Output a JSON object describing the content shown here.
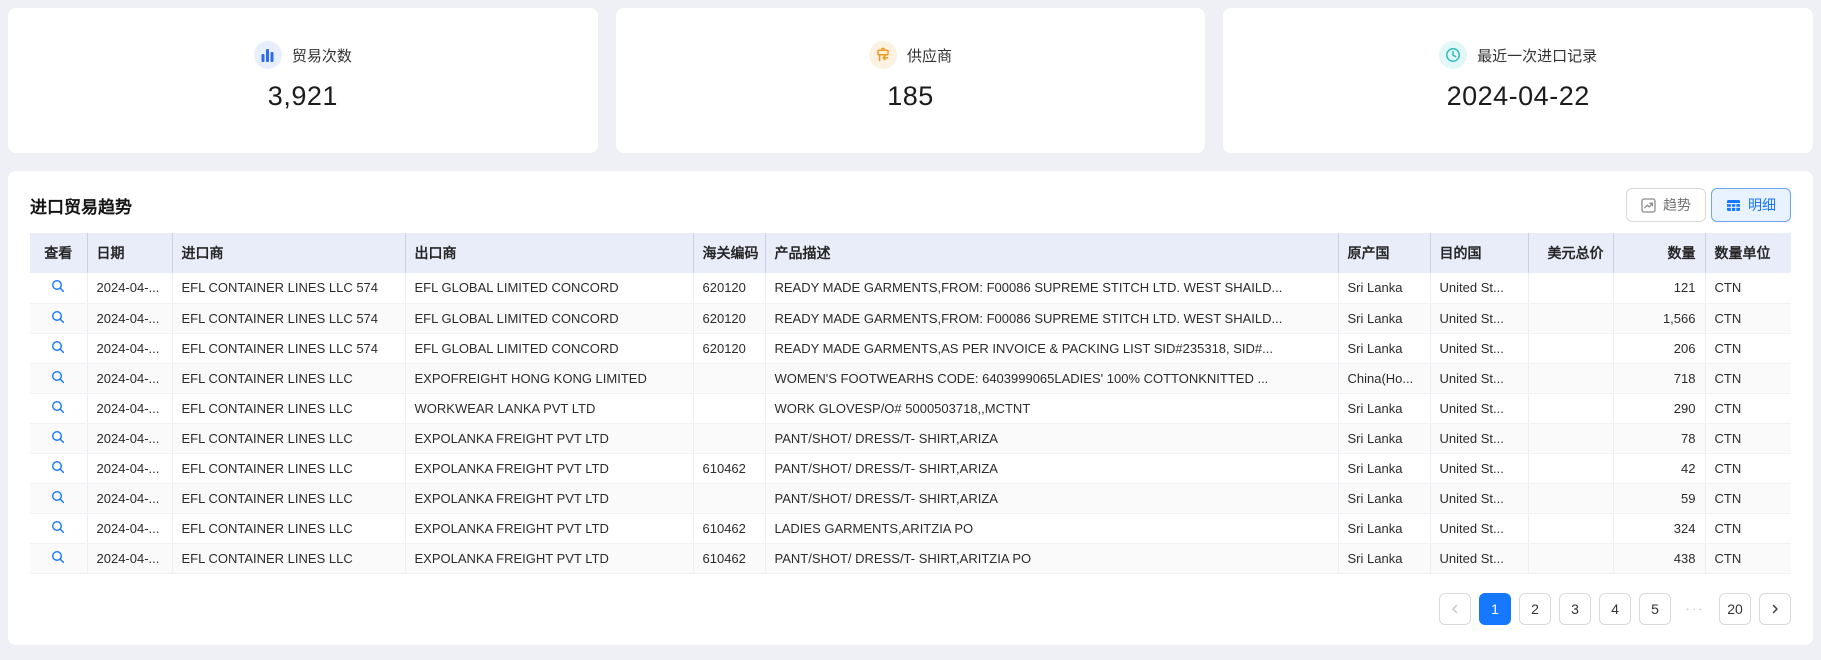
{
  "cards": [
    {
      "icon": "bar-chart-icon",
      "label": "贸易次数",
      "value": "3,921",
      "accent": "#2e6be6",
      "accent_bg": "#e8effc"
    },
    {
      "icon": "supplier-icon",
      "label": "供应商",
      "value": "185",
      "accent": "#f0981f",
      "accent_bg": "#fdf2e2"
    },
    {
      "icon": "clock-icon",
      "label": "最近一次进口记录",
      "value": "2024-04-22",
      "accent": "#2ebdbd",
      "accent_bg": "#e2f7f7"
    }
  ],
  "panel": {
    "title": "进口贸易趋势",
    "view_buttons": {
      "trend": "趋势",
      "detail": "明细",
      "active": "明细"
    },
    "table": {
      "headers": [
        "查看",
        "日期",
        "进口商",
        "出口商",
        "海关编码",
        "产品描述",
        "原产国",
        "目的国",
        "美元总价",
        "数量",
        "数量单位"
      ],
      "rows": [
        {
          "date": "2024-04-...",
          "importer": "EFL CONTAINER LINES LLC 574",
          "exporter": "EFL GLOBAL LIMITED CONCORD",
          "hs_code": "620120",
          "description": "READY MADE GARMENTS,FROM: F00086 SUPREME STITCH LTD. WEST SHAILD...",
          "origin": "Sri Lanka",
          "destination": "United St...",
          "usd_total": "",
          "quantity": "121",
          "unit": "CTN"
        },
        {
          "date": "2024-04-...",
          "importer": "EFL CONTAINER LINES LLC 574",
          "exporter": "EFL GLOBAL LIMITED CONCORD",
          "hs_code": "620120",
          "description": "READY MADE GARMENTS,FROM: F00086 SUPREME STITCH LTD. WEST SHAILD...",
          "origin": "Sri Lanka",
          "destination": "United St...",
          "usd_total": "",
          "quantity": "1,566",
          "unit": "CTN"
        },
        {
          "date": "2024-04-...",
          "importer": "EFL CONTAINER LINES LLC 574",
          "exporter": "EFL GLOBAL LIMITED CONCORD",
          "hs_code": "620120",
          "description": "READY MADE GARMENTS,AS PER INVOICE & PACKING LIST SID#235318, SID#...",
          "origin": "Sri Lanka",
          "destination": "United St...",
          "usd_total": "",
          "quantity": "206",
          "unit": "CTN"
        },
        {
          "date": "2024-04-...",
          "importer": "EFL CONTAINER LINES LLC",
          "exporter": "EXPOFREIGHT HONG KONG LIMITED",
          "hs_code": "",
          "description": "WOMEN'S FOOTWEARHS CODE: 6403999065LADIES' 100% COTTONKNITTED ...",
          "origin": "China(Ho...",
          "destination": "United St...",
          "usd_total": "",
          "quantity": "718",
          "unit": "CTN"
        },
        {
          "date": "2024-04-...",
          "importer": "EFL CONTAINER LINES LLC",
          "exporter": "WORKWEAR LANKA PVT LTD",
          "hs_code": "",
          "description": "WORK GLOVESP/O# 5000503718,,MCTNT",
          "origin": "Sri Lanka",
          "destination": "United St...",
          "usd_total": "",
          "quantity": "290",
          "unit": "CTN"
        },
        {
          "date": "2024-04-...",
          "importer": "EFL CONTAINER LINES LLC",
          "exporter": "EXPOLANKA FREIGHT PVT LTD",
          "hs_code": "",
          "description": "PANT/SHOT/ DRESS/T- SHIRT,ARIZA",
          "origin": "Sri Lanka",
          "destination": "United St...",
          "usd_total": "",
          "quantity": "78",
          "unit": "CTN"
        },
        {
          "date": "2024-04-...",
          "importer": "EFL CONTAINER LINES LLC",
          "exporter": "EXPOLANKA FREIGHT PVT LTD",
          "hs_code": "610462",
          "description": "PANT/SHOT/ DRESS/T- SHIRT,ARIZA",
          "origin": "Sri Lanka",
          "destination": "United St...",
          "usd_total": "",
          "quantity": "42",
          "unit": "CTN"
        },
        {
          "date": "2024-04-...",
          "importer": "EFL CONTAINER LINES LLC",
          "exporter": "EXPOLANKA FREIGHT PVT LTD",
          "hs_code": "",
          "description": "PANT/SHOT/ DRESS/T- SHIRT,ARIZA",
          "origin": "Sri Lanka",
          "destination": "United St...",
          "usd_total": "",
          "quantity": "59",
          "unit": "CTN"
        },
        {
          "date": "2024-04-...",
          "importer": "EFL CONTAINER LINES LLC",
          "exporter": "EXPOLANKA FREIGHT PVT LTD",
          "hs_code": "610462",
          "description": "LADIES GARMENTS,ARITZIA PO",
          "origin": "Sri Lanka",
          "destination": "United St...",
          "usd_total": "",
          "quantity": "324",
          "unit": "CTN"
        },
        {
          "date": "2024-04-...",
          "importer": "EFL CONTAINER LINES LLC",
          "exporter": "EXPOLANKA FREIGHT PVT LTD",
          "hs_code": "610462",
          "description": "PANT/SHOT/ DRESS/T- SHIRT,ARITZIA PO",
          "origin": "Sri Lanka",
          "destination": "United St...",
          "usd_total": "",
          "quantity": "438",
          "unit": "CTN"
        }
      ]
    },
    "pagination": {
      "pages": [
        "1",
        "2",
        "3",
        "4",
        "5"
      ],
      "ellipsis": "···",
      "last_page": "20",
      "active_page": "1"
    }
  },
  "colors": {
    "accent_blue": "#1677ff",
    "header_bg": "#e9edf9",
    "page_bg": "#eef0f5"
  }
}
